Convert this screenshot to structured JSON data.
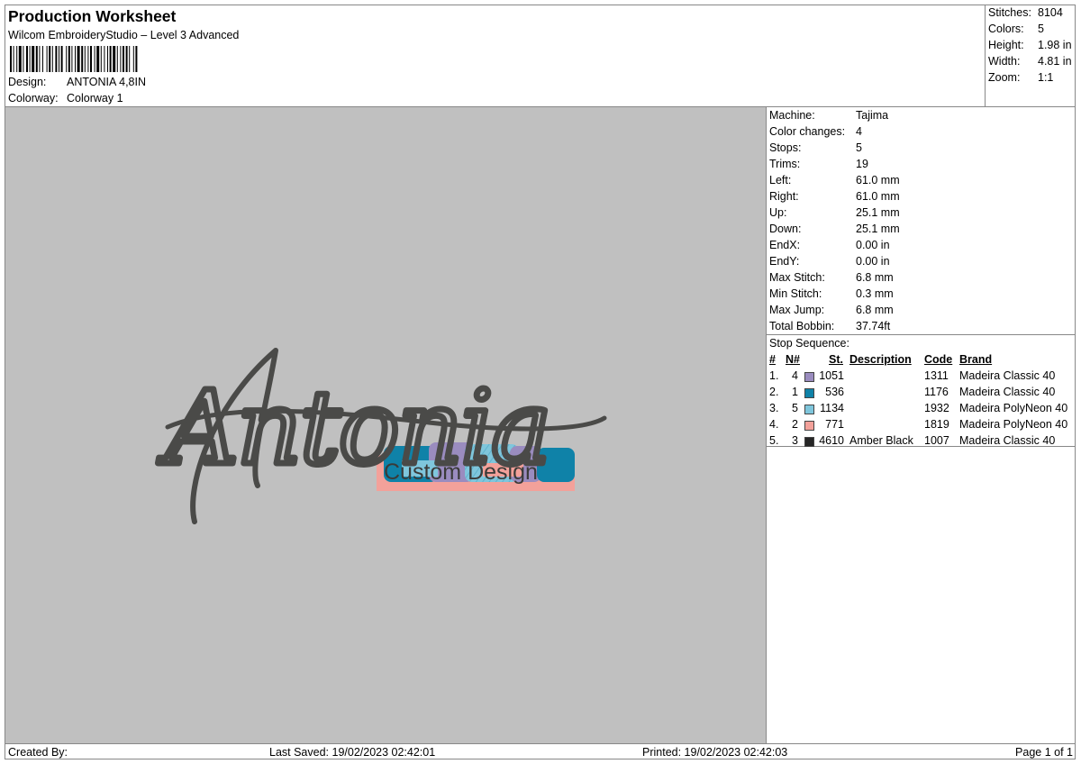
{
  "header": {
    "title": "Production Worksheet",
    "subtitle": "Wilcom EmbroideryStudio – Level 3 Advanced",
    "design_label": "Design:",
    "design_value": "ANTONIA 4,8IN",
    "colorway_label": "Colorway:",
    "colorway_value": "Colorway 1"
  },
  "summary": [
    {
      "label": "Stitches:",
      "value": "8104"
    },
    {
      "label": "Colors:",
      "value": "5"
    },
    {
      "label": "Height:",
      "value": "1.98 in"
    },
    {
      "label": "Width:",
      "value": "4.81 in"
    },
    {
      "label": "Zoom:",
      "value": "1:1"
    }
  ],
  "design": {
    "script_text": "Antonia",
    "tagline": "Custom Design",
    "thread_color": "#4a4a48",
    "background": "#c0c0c0"
  },
  "machine_info": [
    {
      "label": "Machine:",
      "value": "Tajima"
    },
    {
      "label": "Color changes:",
      "value": "4"
    },
    {
      "label": "Stops:",
      "value": "5"
    },
    {
      "label": "Trims:",
      "value": "19"
    },
    {
      "label": "Left:",
      "value": "61.0 mm"
    },
    {
      "label": "Right:",
      "value": "61.0 mm"
    },
    {
      "label": "Up:",
      "value": "25.1 mm"
    },
    {
      "label": "Down:",
      "value": "25.1 mm"
    },
    {
      "label": "EndX:",
      "value": "0.00 in"
    },
    {
      "label": "EndY:",
      "value": "0.00 in"
    },
    {
      "label": "Max Stitch:",
      "value": "6.8 mm"
    },
    {
      "label": "Min Stitch:",
      "value": "0.3 mm"
    },
    {
      "label": "Max Jump:",
      "value": "6.8 mm"
    },
    {
      "label": "Total Bobbin:",
      "value": "37.74ft"
    }
  ],
  "stop_sequence": {
    "caption": "Stop Sequence:",
    "headers": {
      "num": "#",
      "n": "N#",
      "st": "St.",
      "desc": "Description",
      "code": "Code",
      "brand": "Brand"
    },
    "rows": [
      {
        "num": "1.",
        "n": "4",
        "color": "#9a8cbf",
        "st": "1051",
        "desc": "",
        "code": "1311",
        "brand": "Madeira Classic 40"
      },
      {
        "num": "2.",
        "n": "1",
        "color": "#0f82a8",
        "st": "536",
        "desc": "",
        "code": "1176",
        "brand": "Madeira Classic 40"
      },
      {
        "num": "3.",
        "n": "5",
        "color": "#7fc6dc",
        "st": "1134",
        "desc": "",
        "code": "1932",
        "brand": "Madeira PolyNeon 40"
      },
      {
        "num": "4.",
        "n": "2",
        "color": "#f3a19a",
        "st": "771",
        "desc": "",
        "code": "1819",
        "brand": "Madeira PolyNeon 40"
      },
      {
        "num": "5.",
        "n": "3",
        "color": "#262626",
        "st": "4610",
        "desc": "Amber Black",
        "code": "1007",
        "brand": "Madeira Classic 40"
      }
    ]
  },
  "footer": {
    "created": "Created By:",
    "last_saved": "Last Saved: 19/02/2023 02:42:01",
    "printed": "Printed: 19/02/2023 02:42:03",
    "page": "Page 1 of 1"
  }
}
